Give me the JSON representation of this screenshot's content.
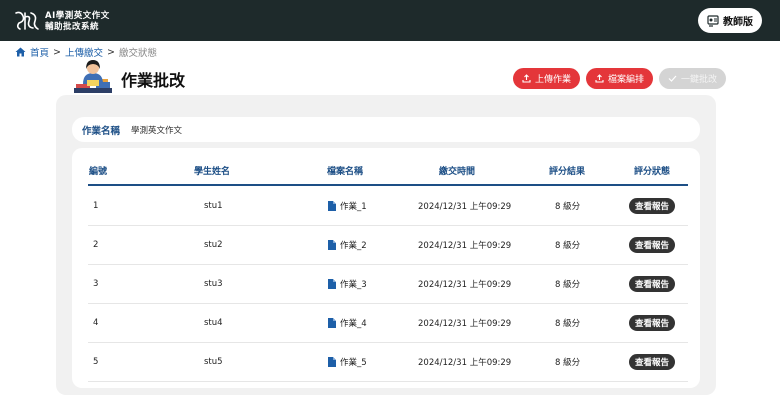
{
  "header": {
    "title_line1": "AI學測英文作文",
    "title_line2": "輔助批改系統",
    "teacher_label": "教師版"
  },
  "breadcrumb": {
    "home": "首頁",
    "sep1": ">",
    "upload": "上傳繳交",
    "sep2": ">",
    "current": "繳交狀態"
  },
  "page": {
    "title": "作業批改"
  },
  "actions": {
    "upload_label": "上傳作業",
    "arrange_label": "檔案編排",
    "grade_all_label": "一鍵批改"
  },
  "assignment": {
    "label": "作業名稱",
    "value": "學測英文作文"
  },
  "table": {
    "headers": {
      "id": "編號",
      "student": "學生姓名",
      "file": "檔案名稱",
      "time": "繳交時間",
      "score": "評分結果",
      "status": "評分狀態"
    },
    "rows": [
      {
        "id": "1",
        "student": "stu1",
        "file": "作業_1",
        "time": "2024/12/31 上午09:29",
        "score": "8 級分",
        "status": "查看報告"
      },
      {
        "id": "2",
        "student": "stu2",
        "file": "作業_2",
        "time": "2024/12/31 上午09:29",
        "score": "8 級分",
        "status": "查看報告"
      },
      {
        "id": "3",
        "student": "stu3",
        "file": "作業_3",
        "time": "2024/12/31 上午09:29",
        "score": "8 級分",
        "status": "查看報告"
      },
      {
        "id": "4",
        "student": "stu4",
        "file": "作業_4",
        "time": "2024/12/31 上午09:29",
        "score": "8 級分",
        "status": "查看報告"
      },
      {
        "id": "5",
        "student": "stu5",
        "file": "作業_5",
        "time": "2024/12/31 上午09:29",
        "score": "8 級分",
        "status": "查看報告"
      }
    ]
  },
  "colors": {
    "header_bg": "#1e2a2b",
    "accent_red": "#e4363a",
    "accent_blue": "#1d4f86",
    "panel_bg": "#f1f1f1"
  },
  "icons": [
    "logo-icon",
    "teacher-icon",
    "home-icon",
    "avatar-illustration",
    "upload-icon",
    "check-icon",
    "file-icon"
  ]
}
